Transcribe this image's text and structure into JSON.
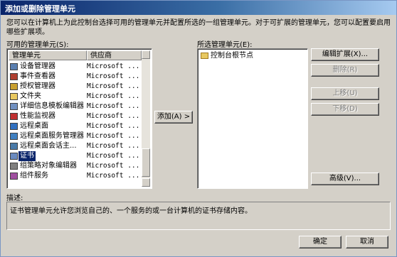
{
  "window": {
    "title": "添加或删除管理单元"
  },
  "intro": "您可以在计算机上为此控制台选择可用的管理单元并配置所选的一组管理单元。对于可扩展的管理单元，您可以配置要启用哪些扩展项。",
  "available": {
    "label": "可用的管理单元(S):",
    "columns": [
      "管理单元",
      "供应商"
    ],
    "items": [
      {
        "name": "设备管理器",
        "vendor": "Microsoft ...",
        "icon": "device-manager-icon"
      },
      {
        "name": "事件查看器",
        "vendor": "Microsoft ...",
        "icon": "event-viewer-icon"
      },
      {
        "name": "授权管理器",
        "vendor": "Microsoft ...",
        "icon": "authorization-manager-icon"
      },
      {
        "name": "文件夹",
        "vendor": "Microsoft ...",
        "icon": "folder-icon"
      },
      {
        "name": "详细信息模板编辑器",
        "vendor": "Microsoft ...",
        "icon": "template-editor-icon"
      },
      {
        "name": "性能监视器",
        "vendor": "Microsoft ...",
        "icon": "performance-monitor-icon"
      },
      {
        "name": "远程桌面",
        "vendor": "Microsoft ...",
        "icon": "remote-desktop-icon"
      },
      {
        "name": "远程桌面服务管理器",
        "vendor": "Microsoft ...",
        "icon": "remote-desktop-services-icon"
      },
      {
        "name": "远程桌面会话主...",
        "vendor": "Microsoft ...",
        "icon": "remote-desktop-session-icon"
      },
      {
        "name": "证书",
        "vendor": "Microsoft ...",
        "icon": "certificate-icon",
        "selected": true
      },
      {
        "name": "组策略对象编辑器",
        "vendor": "Microsoft ...",
        "icon": "group-policy-icon"
      },
      {
        "name": "组件服务",
        "vendor": "Microsoft ...",
        "icon": "component-services-icon"
      }
    ]
  },
  "add_button": "添加(A) >",
  "selected": {
    "label": "所选管理单元(E):",
    "items": [
      {
        "name": "控制台根节点",
        "icon": "folder-icon"
      }
    ]
  },
  "buttons": {
    "edit_extensions": "编辑扩展(X)...",
    "remove": "删除(R)",
    "move_up": "上移(U)",
    "move_down": "下移(D)",
    "advanced": "高级(V)...",
    "ok": "确定",
    "cancel": "取消"
  },
  "description": {
    "label": "描述:",
    "text": "证书管理单元允许您浏览自己的、一个服务的或一台计算机的证书存储内容。"
  },
  "colors": {
    "title_start": "#0a246a",
    "title_end": "#a6caf0",
    "selection": "#0a246a",
    "face": "#d4d0c8"
  }
}
